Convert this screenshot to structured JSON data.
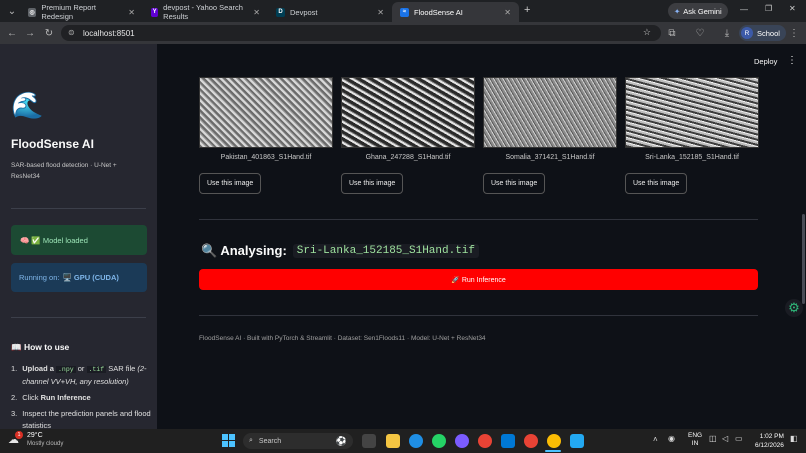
{
  "browser": {
    "tabs": [
      {
        "label": "Premium Report Redesign",
        "fav": "#5f6368",
        "glyph": "◎"
      },
      {
        "label": "devpost - Yahoo Search Results",
        "fav": "#6001d2",
        "glyph": "Y"
      },
      {
        "label": "Devpost",
        "fav": "#003e54",
        "glyph": "D"
      },
      {
        "label": "FloodSense AI",
        "fav": "#1a73e8",
        "glyph": "≈"
      }
    ],
    "new_tab": "+",
    "gemini": "Ask Gemini",
    "url": "localhost:8501",
    "profile": "School",
    "profile_initial": "R"
  },
  "sidebar": {
    "logo_glyph": "🌊",
    "title": "FloodSense AI",
    "subtitle": "SAR-based flood detection · U-Net + ResNet34",
    "model_status": "🧠 ✅ Model loaded",
    "running_on_label": "Running on:",
    "running_on_value": "🖥️ GPU (CUDA)",
    "howto_title": "📖 How to use",
    "steps": [
      {
        "n": "1.",
        "pre": "Upload a",
        "code1": ".npy",
        "mid": "or",
        "code2": ".tif",
        "post": "SAR file",
        "note": "(2-channel VV+VH, any resolution)"
      },
      {
        "n": "2.",
        "pre": "Click",
        "bold": "Run Inference"
      },
      {
        "n": "3.",
        "text": "Inspect the prediction panels and flood statistics"
      }
    ]
  },
  "main": {
    "deploy": "Deploy",
    "samples": [
      {
        "name": "Pakistan_401863_S1Hand.tif",
        "button": "Use this image"
      },
      {
        "name": "Ghana_247288_S1Hand.tif",
        "button": "Use this image"
      },
      {
        "name": "Somalia_371421_S1Hand.tif",
        "button": "Use this image"
      },
      {
        "name": "Sri-Lanka_152185_S1Hand.tif",
        "button": "Use this image"
      }
    ],
    "analysing_label": "🔍 Analysing:",
    "analysing_file": "Sri-Lanka_152185_S1Hand.tif",
    "run_label": "🚀 Run Inference",
    "footer": "FloodSense AI · Built with PyTorch & Streamlit · Dataset: Sen1Floods11 · Model: U-Net + ResNet34"
  },
  "taskbar": {
    "weather_temp": "29°C",
    "weather_desc": "Mostly cloudy",
    "weather_badge": "1",
    "search_placeholder": "Search",
    "lang1": "ENG",
    "lang2": "IN",
    "time": "1:02 PM",
    "date": "6/12/2026"
  }
}
